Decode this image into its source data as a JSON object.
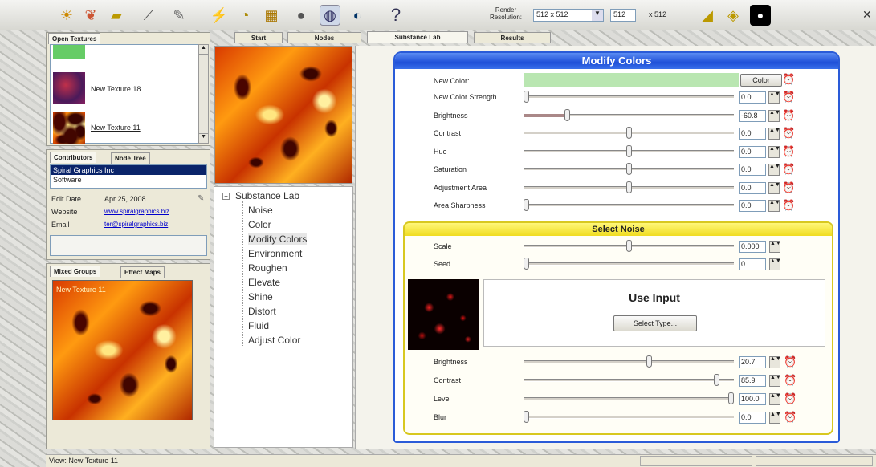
{
  "toolbar": {
    "icons": [
      "sun-icon",
      "leaf-icon",
      "paint-icon",
      "brush-icon",
      "shapes-icon",
      "bolt-icon",
      "grid-icon",
      "sphere-icon",
      "render-icon",
      "globe-icon",
      "help-icon",
      "tiles-icon",
      "export-icon",
      "preview-icon"
    ],
    "render_resolution_label": "Render\nResolution:",
    "resolution_select": "512 x 512",
    "width_value": "512",
    "height_label": "x 512",
    "close_glyph": "✕"
  },
  "open_textures": {
    "tab": "Open Textures",
    "items": [
      {
        "label": ""
      },
      {
        "label": "New Texture 18"
      },
      {
        "label": "New Texture 11"
      }
    ]
  },
  "main_tabs": [
    "Start",
    "Nodes",
    "Substance Lab",
    "Results"
  ],
  "contributors": {
    "tabs": [
      "Contributors",
      "Node Tree"
    ],
    "list": [
      "Spiral Graphics Inc",
      "Software"
    ],
    "edit_date_label": "Edit Date",
    "edit_date": "Apr 25, 2008",
    "website_label": "Website",
    "website": "www.spiralgraphics.biz",
    "email_label": "Email",
    "email": "ter@spiralgraphics.biz"
  },
  "bottom_left": {
    "tabs": [
      "Mixed Groups",
      "Effect Maps"
    ],
    "overlay_text": "New Texture 11"
  },
  "tree": {
    "root": "Substance Lab",
    "items": [
      "Noise",
      "Color",
      "Modify Colors",
      "Environment",
      "Roughen",
      "Elevate",
      "Shine",
      "Distort",
      "Fluid",
      "Adjust Color"
    ],
    "selected": "Modify Colors"
  },
  "modify_colors": {
    "title": "Modify Colors",
    "new_color_label": "New Color:",
    "new_color_hex": "#b9e6b1",
    "color_button": "Color",
    "rows": [
      {
        "label": "New Color Strength",
        "value": "0.0",
        "level": 0.0
      },
      {
        "label": "Brightness",
        "value": "-60.8",
        "level": 0.2
      },
      {
        "label": "Contrast",
        "value": "0.0",
        "level": 0.5
      },
      {
        "label": "Hue",
        "value": "0.0",
        "level": 0.5
      },
      {
        "label": "Saturation",
        "value": "0.0",
        "level": 0.5
      },
      {
        "label": "Adjustment Area",
        "value": "0.0",
        "level": 0.5
      },
      {
        "label": "Area Sharpness",
        "value": "0.0",
        "level": 0.0
      }
    ]
  },
  "select_noise": {
    "title": "Select Noise",
    "rows": [
      {
        "label": "Scale",
        "value": "0.000",
        "level": 0.5
      },
      {
        "label": "Seed",
        "value": "0",
        "level": 0.0
      }
    ],
    "use_input": "Use Input",
    "select_type_button": "Select Type...",
    "lower_rows": [
      {
        "label": "Brightness",
        "value": "20.7",
        "level": 0.6
      },
      {
        "label": "Contrast",
        "value": "85.9",
        "level": 0.93
      },
      {
        "label": "Level",
        "value": "100.0",
        "level": 1.0
      },
      {
        "label": "Blur",
        "value": "0.0",
        "level": 0.0
      }
    ]
  },
  "status": {
    "text": "View: New Texture 11"
  }
}
